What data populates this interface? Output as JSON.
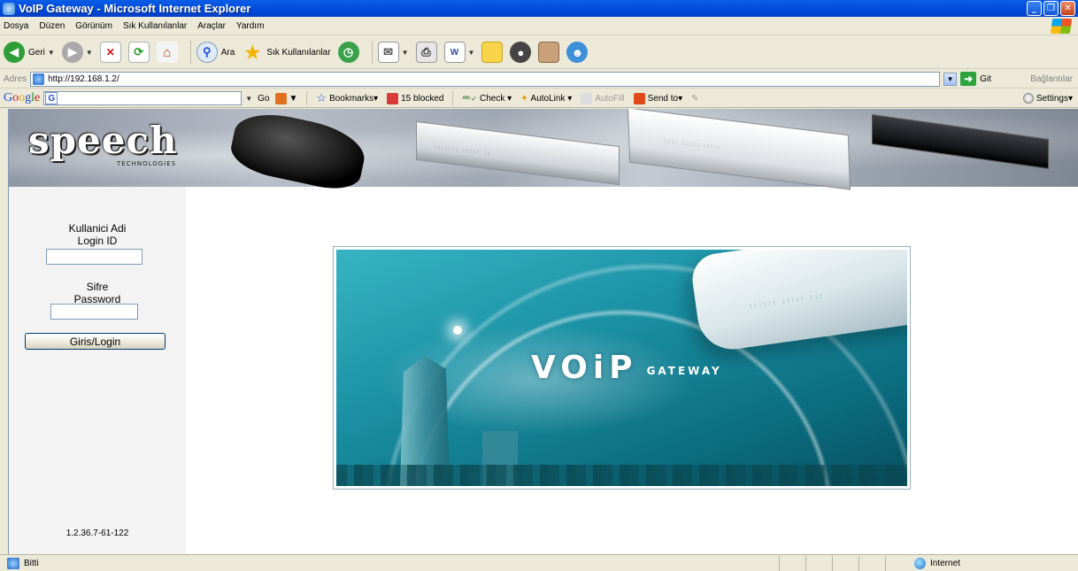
{
  "window": {
    "title": "VoIP Gateway - Microsoft Internet Explorer"
  },
  "menu": [
    "Dosya",
    "Düzen",
    "Görünüm",
    "Sık Kullanılanlar",
    "Araçlar",
    "Yardım"
  ],
  "toolbar": {
    "back_label": "Geri",
    "search_label": "Ara",
    "favorites_label": "Sık Kullanılanlar"
  },
  "address": {
    "label": "Adres",
    "url": "http://192.168.1.2/",
    "go_label": "Git",
    "links_label": "Bağlantılar"
  },
  "google": {
    "go_label": "Go",
    "bookmarks_label": "Bookmarks",
    "blocked_label": "15 blocked",
    "check_label": "Check",
    "autolink_label": "AutoLink",
    "autofill_label": "AutoFill",
    "sendto_label": "Send to",
    "settings_label": "Settings"
  },
  "page": {
    "logo_text": "speech",
    "logo_sub": "TECHNOLOGIES",
    "login": {
      "user_label_tr": "Kullanici Adi",
      "user_label_en": "Login ID",
      "user_value": "",
      "pass_label_tr": "Sifre",
      "pass_label_en": "Password",
      "pass_value": "",
      "button_label": "Giris/Login"
    },
    "version": "1.2.36.7-61-122",
    "splash": {
      "title": "VOiP",
      "subtitle": "GATEWAY"
    }
  },
  "status": {
    "text": "Bitti",
    "zone": "Internet"
  }
}
